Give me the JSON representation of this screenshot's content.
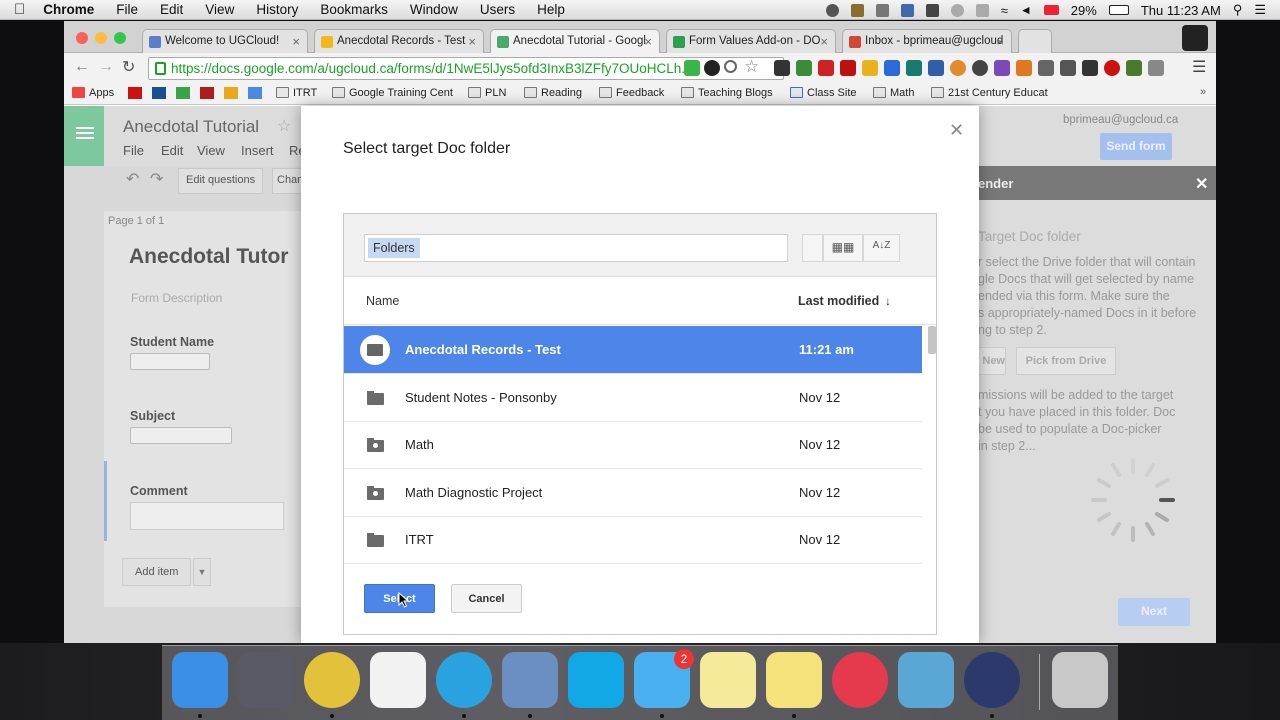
{
  "menubar": {
    "app_name": "Chrome",
    "items": [
      "File",
      "Edit",
      "View",
      "History",
      "Bookmarks",
      "Window",
      "Users",
      "Help"
    ],
    "battery": "29%",
    "clock": "Thu 11:23 AM"
  },
  "tabs": [
    {
      "label": "Welcome to UGCloud!",
      "favicon_color": "#5b7fc7"
    },
    {
      "label": "Anecdotal Records - Test",
      "favicon_color": "#f2b81c"
    },
    {
      "label": "Anecdotal Tutorial - Googl",
      "favicon_color": "#4aa96c"
    },
    {
      "label": "Form Values Add-on - DO",
      "favicon_color": "#2e9e50"
    },
    {
      "label": "Inbox - bprimeau@ugcloud",
      "favicon_color": "#d44638"
    }
  ],
  "url": "https://docs.google.com/a/ugcloud.ca/forms/d/1NwE5lJys5ofd3InxB3lZFfy7OUoHCLh...",
  "bookmarks": [
    "Apps",
    "ITRT",
    "Google Training Cent",
    "PLN",
    "Reading",
    "Feedback",
    "Teaching Blogs",
    "Class Site",
    "Math",
    "21st Century Educat"
  ],
  "form": {
    "doc_title": "Anecdotal Tutorial",
    "menu": [
      "File",
      "Edit",
      "View",
      "Insert",
      "Re"
    ],
    "edit_questions_label": "Edit questions",
    "change_label": "Chan",
    "page_indicator": "Page 1 of 1",
    "form_title": "Anecdotal Tutor",
    "form_description": "Form Description",
    "fields": [
      "Student Name",
      "Subject",
      "Comment"
    ],
    "add_item_label": "Add item",
    "user_email": "bprimeau@ugcloud.ca",
    "send_form_label": "Send form"
  },
  "side_panel": {
    "header": "ender",
    "heading": "Target Doc folder",
    "desc1": "r select the Drive folder that will contain",
    "desc2": "gle Docs that will get selected by name",
    "desc3": "ended via this form. Make sure the",
    "desc4": "s appropriately-named Docs in it before",
    "desc5": "ng to step 2.",
    "btn_new": "New",
    "btn_pick": "Pick from Drive",
    "note1": "missions will be added to the target",
    "note2": "t you have placed in this folder. Doc",
    "note3": "be used to populate a Doc-picker",
    "note4": "in step 2...",
    "next_label": "Next"
  },
  "dialog": {
    "title": "Select target Doc folder",
    "search_chip": "Folders",
    "col_name": "Name",
    "col_modified": "Last modified",
    "rows": [
      {
        "name": "Anecdotal Records - Test",
        "modified": "11:21 am",
        "selected": true,
        "shared": false
      },
      {
        "name": "Student Notes - Ponsonby",
        "modified": "Nov 12",
        "selected": false,
        "shared": false
      },
      {
        "name": "Math",
        "modified": "Nov 12",
        "selected": false,
        "shared": true
      },
      {
        "name": "Math Diagnostic Project",
        "modified": "Nov 12",
        "selected": false,
        "shared": true
      },
      {
        "name": "ITRT",
        "modified": "Nov 12",
        "selected": false,
        "shared": false
      }
    ],
    "select_label": "Select",
    "cancel_label": "Cancel"
  },
  "dock": {
    "apps": [
      "finder-icon",
      "launchpad-icon",
      "chrome-icon",
      "grid-app-icon",
      "network-app-icon",
      "mail-stamp-icon",
      "skype-icon",
      "messages-icon",
      "notes-icon",
      "stickies-icon",
      "itunes-icon",
      "writer-app-icon",
      "quicktime-icon",
      "trash-icon"
    ],
    "messages_badge": "2"
  },
  "colors": {
    "accent": "#4d86e8",
    "forms_green": "#7ec89d"
  }
}
